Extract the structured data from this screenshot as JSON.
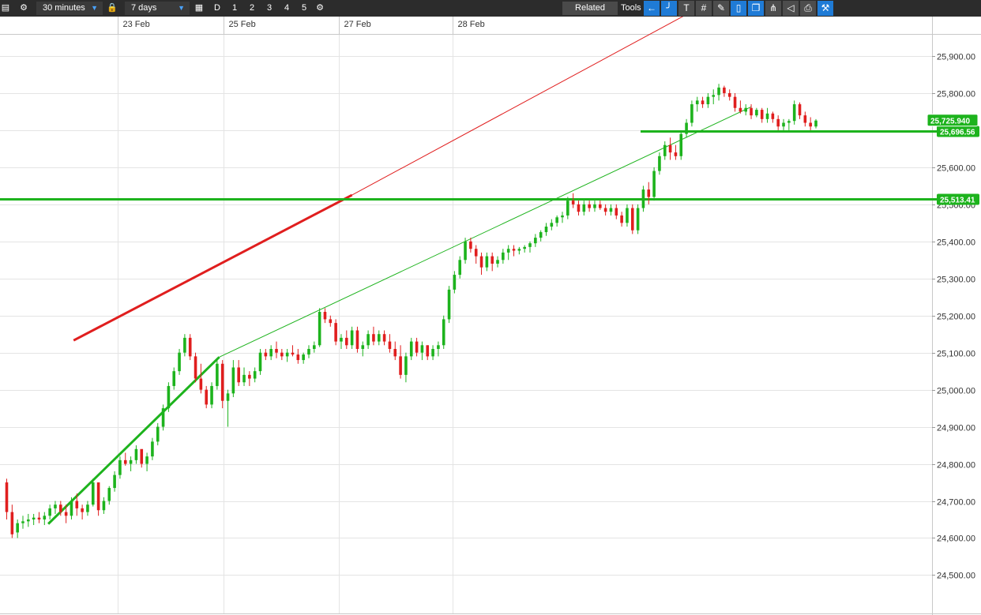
{
  "toolbar": {
    "interval": "30 minutes",
    "range": "7 days",
    "period_buttons": [
      "D",
      "1",
      "2",
      "3",
      "4",
      "5"
    ],
    "related_label": "Related",
    "tools_label": "Tools",
    "tool_icons": [
      "back-arrow-icon",
      "curve-icon",
      "text-tool-icon",
      "grid-icon",
      "pencil-grid-icon",
      "candle-icon",
      "layers-icon",
      "fork-icon",
      "eraser-icon",
      "print-icon",
      "settings-tools-icon"
    ]
  },
  "chart_data": {
    "type": "candlestick",
    "x_labels": [
      "23 Feb",
      "25 Feb",
      "27 Feb",
      "28 Feb"
    ],
    "y_ticks": [
      "25,900.00",
      "25,800.00",
      "25,700.00",
      "25,600.00",
      "25,500.00",
      "25,400.00",
      "25,300.00",
      "25,200.00",
      "25,100.00",
      "25,000.00",
      "24,900.00",
      "24,800.00",
      "24,700.00",
      "24,600.00",
      "24,500.00"
    ],
    "y_range": [
      24465,
      25990
    ],
    "current_price": "25,725.940",
    "horizontal_levels": [
      {
        "value": 25696.56,
        "label": "25,696.56",
        "color": "#1db31d"
      },
      {
        "value": 25513.41,
        "label": "25,513.41",
        "color": "#1db31d"
      }
    ],
    "candles": [
      [
        24750,
        24760,
        24650,
        24670
      ],
      [
        24670,
        24690,
        24600,
        24610
      ],
      [
        24615,
        24650,
        24600,
        24640
      ],
      [
        24640,
        24660,
        24625,
        24645
      ],
      [
        24645,
        24665,
        24630,
        24650
      ],
      [
        24650,
        24665,
        24635,
        24655
      ],
      [
        24655,
        24670,
        24640,
        24650
      ],
      [
        24650,
        24670,
        24635,
        24660
      ],
      [
        24660,
        24690,
        24650,
        24680
      ],
      [
        24680,
        24700,
        24665,
        24690
      ],
      [
        24690,
        24700,
        24660,
        24670
      ],
      [
        24670,
        24690,
        24640,
        24660
      ],
      [
        24660,
        24710,
        24650,
        24700
      ],
      [
        24700,
        24720,
        24660,
        24680
      ],
      [
        24680,
        24690,
        24650,
        24670
      ],
      [
        24670,
        24700,
        24660,
        24690
      ],
      [
        24690,
        24760,
        24685,
        24750
      ],
      [
        24750,
        24710,
        24660,
        24675
      ],
      [
        24675,
        24710,
        24665,
        24700
      ],
      [
        24700,
        24740,
        24690,
        24735
      ],
      [
        24735,
        24780,
        24725,
        24770
      ],
      [
        24770,
        24820,
        24760,
        24810
      ],
      [
        24810,
        24830,
        24795,
        24800
      ],
      [
        24800,
        24820,
        24780,
        24810
      ],
      [
        24810,
        24850,
        24800,
        24840
      ],
      [
        24840,
        24830,
        24790,
        24800
      ],
      [
        24800,
        24830,
        24780,
        24820
      ],
      [
        24820,
        24870,
        24810,
        24860
      ],
      [
        24860,
        24910,
        24850,
        24900
      ],
      [
        24900,
        24960,
        24890,
        24950
      ],
      [
        24950,
        25020,
        24940,
        25010
      ],
      [
        25010,
        25060,
        25000,
        25050
      ],
      [
        25050,
        25110,
        25040,
        25100
      ],
      [
        25100,
        25150,
        25090,
        25140
      ],
      [
        25140,
        25150,
        25080,
        25090
      ],
      [
        25090,
        25100,
        25020,
        25030
      ],
      [
        25030,
        25070,
        24990,
        25000
      ],
      [
        25000,
        25010,
        24950,
        24960
      ],
      [
        24960,
        25020,
        24950,
        25010
      ],
      [
        25010,
        25080,
        25000,
        25070
      ],
      [
        25070,
        25080,
        24950,
        24970
      ],
      [
        24970,
        25000,
        24900,
        24990
      ],
      [
        24990,
        25080,
        24980,
        25060
      ],
      [
        25060,
        25080,
        25010,
        25020
      ],
      [
        25020,
        25060,
        25010,
        25040
      ],
      [
        25040,
        25050,
        25010,
        25030
      ],
      [
        25030,
        25060,
        25020,
        25050
      ],
      [
        25050,
        25110,
        25040,
        25100
      ],
      [
        25100,
        25110,
        25080,
        25090
      ],
      [
        25090,
        25120,
        25080,
        25110
      ],
      [
        25110,
        25130,
        25085,
        25100
      ],
      [
        25100,
        25110,
        25080,
        25090
      ],
      [
        25090,
        25110,
        25075,
        25100
      ],
      [
        25100,
        25120,
        25090,
        25095
      ],
      [
        25095,
        25110,
        25070,
        25080
      ],
      [
        25080,
        25100,
        25070,
        25095
      ],
      [
        25095,
        25120,
        25085,
        25110
      ],
      [
        25110,
        25130,
        25100,
        25120
      ],
      [
        25120,
        25220,
        25115,
        25210
      ],
      [
        25210,
        25220,
        25180,
        25190
      ],
      [
        25190,
        25200,
        25170,
        25180
      ],
      [
        25180,
        25190,
        25120,
        25130
      ],
      [
        25130,
        25150,
        25110,
        25140
      ],
      [
        25140,
        25160,
        25110,
        25120
      ],
      [
        25120,
        25170,
        25110,
        25160
      ],
      [
        25160,
        25170,
        25100,
        25110
      ],
      [
        25110,
        25130,
        25090,
        25120
      ],
      [
        25120,
        25160,
        25110,
        25150
      ],
      [
        25150,
        25170,
        25120,
        25130
      ],
      [
        25130,
        25160,
        25120,
        25150
      ],
      [
        25150,
        25160,
        25120,
        25130
      ],
      [
        25130,
        25150,
        25100,
        25110
      ],
      [
        25110,
        25130,
        25080,
        25090
      ],
      [
        25090,
        25120,
        25030,
        25040
      ],
      [
        25040,
        25100,
        25020,
        25090
      ],
      [
        25090,
        25140,
        25080,
        25130
      ],
      [
        25130,
        25140,
        25090,
        25100
      ],
      [
        25100,
        25130,
        25080,
        25120
      ],
      [
        25120,
        25120,
        25080,
        25090
      ],
      [
        25090,
        25120,
        25080,
        25110
      ],
      [
        25110,
        25130,
        25090,
        25120
      ],
      [
        25120,
        25200,
        25110,
        25190
      ],
      [
        25190,
        25280,
        25180,
        25270
      ],
      [
        25270,
        25320,
        25260,
        25310
      ],
      [
        25310,
        25360,
        25300,
        25350
      ],
      [
        25350,
        25410,
        25340,
        25400
      ],
      [
        25400,
        25410,
        25370,
        25380
      ],
      [
        25380,
        25390,
        25340,
        25360
      ],
      [
        25360,
        25370,
        25310,
        25330
      ],
      [
        25330,
        25370,
        25320,
        25360
      ],
      [
        25360,
        25370,
        25320,
        25340
      ],
      [
        25340,
        25360,
        25330,
        25350
      ],
      [
        25350,
        25380,
        25340,
        25370
      ],
      [
        25370,
        25390,
        25350,
        25380
      ],
      [
        25380,
        25390,
        25360,
        25375
      ],
      [
        25375,
        25385,
        25365,
        25380
      ],
      [
        25380,
        25390,
        25370,
        25385
      ],
      [
        25385,
        25400,
        25370,
        25395
      ],
      [
        25395,
        25420,
        25385,
        25410
      ],
      [
        25410,
        25430,
        25400,
        25425
      ],
      [
        25425,
        25450,
        25415,
        25440
      ],
      [
        25440,
        25460,
        25430,
        25450
      ],
      [
        25450,
        25470,
        25440,
        25465
      ],
      [
        25465,
        25480,
        25450,
        25470
      ],
      [
        25470,
        25520,
        25460,
        25510
      ],
      [
        25510,
        25530,
        25490,
        25500
      ],
      [
        25500,
        25510,
        25470,
        25480
      ],
      [
        25480,
        25510,
        25470,
        25500
      ],
      [
        25500,
        25510,
        25480,
        25490
      ],
      [
        25490,
        25510,
        25480,
        25500
      ],
      [
        25500,
        25510,
        25485,
        25490
      ],
      [
        25490,
        25500,
        25470,
        25480
      ],
      [
        25480,
        25500,
        25470,
        25490
      ],
      [
        25490,
        25500,
        25460,
        25470
      ],
      [
        25470,
        25480,
        25440,
        25450
      ],
      [
        25450,
        25500,
        25440,
        25490
      ],
      [
        25490,
        25500,
        25420,
        25430
      ],
      [
        25430,
        25500,
        25420,
        25490
      ],
      [
        25490,
        25550,
        25480,
        25540
      ],
      [
        25540,
        25560,
        25500,
        25520
      ],
      [
        25520,
        25600,
        25510,
        25590
      ],
      [
        25590,
        25640,
        25580,
        25630
      ],
      [
        25630,
        25670,
        25620,
        25660
      ],
      [
        25660,
        25680,
        25620,
        25640
      ],
      [
        25640,
        25660,
        25620,
        25630
      ],
      [
        25630,
        25700,
        25620,
        25690
      ],
      [
        25690,
        25730,
        25680,
        25720
      ],
      [
        25720,
        25780,
        25710,
        25770
      ],
      [
        25770,
        25790,
        25750,
        25780
      ],
      [
        25780,
        25790,
        25760,
        25770
      ],
      [
        25770,
        25800,
        25760,
        25790
      ],
      [
        25790,
        25810,
        25770,
        25795
      ],
      [
        25795,
        25825,
        25780,
        25815
      ],
      [
        25815,
        25820,
        25790,
        25800
      ],
      [
        25800,
        25810,
        25780,
        25790
      ],
      [
        25790,
        25800,
        25750,
        25760
      ],
      [
        25760,
        25780,
        25745,
        25750
      ],
      [
        25750,
        25770,
        25740,
        25760
      ],
      [
        25760,
        25770,
        25730,
        25740
      ],
      [
        25740,
        25760,
        25735,
        25755
      ],
      [
        25755,
        25760,
        25720,
        25730
      ],
      [
        25730,
        25760,
        25720,
        25745
      ],
      [
        25745,
        25750,
        25720,
        25730
      ],
      [
        25730,
        25740,
        25700,
        25710
      ],
      [
        25710,
        25730,
        25700,
        25720
      ],
      [
        25720,
        25730,
        25700,
        25725
      ],
      [
        25725,
        25780,
        25715,
        25770
      ],
      [
        25770,
        25775,
        25730,
        25740
      ],
      [
        25740,
        25750,
        25710,
        25720
      ],
      [
        25720,
        25735,
        25700,
        25710
      ],
      [
        25710,
        25730,
        25705,
        25726
      ]
    ],
    "trendlines": [
      {
        "color": "#e01e1e",
        "p1": [
          12.4,
          25133
        ],
        "p2": [
          64,
          25525
        ],
        "extend_to": [
          136.8,
          26097
        ],
        "width": "thick_then_thin"
      },
      {
        "color": "#1db31d",
        "p1": [
          7.7,
          24638
        ],
        "p2": [
          39.4,
          25088
        ],
        "extend_to": [
          138,
          25763
        ],
        "width": "thick_then_thin"
      }
    ],
    "x_date_index": {
      "23 Feb": 20.6,
      "25 Feb": 40.2,
      "27 Feb": 61.5,
      "28 Feb": 82.6
    }
  }
}
